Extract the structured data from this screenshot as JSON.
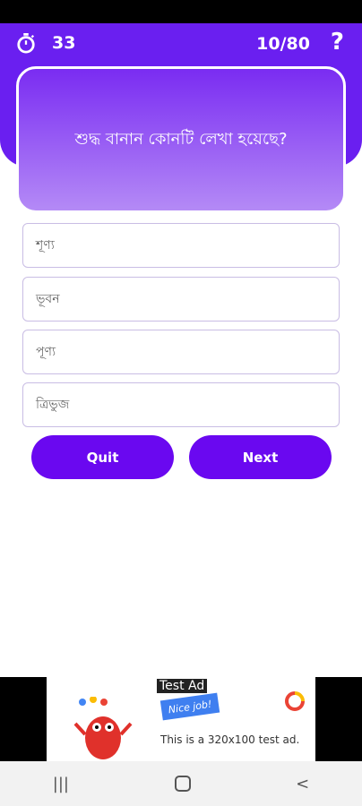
{
  "header": {
    "timer_value": "33",
    "progress": "10/80",
    "help_icon": "?"
  },
  "question": {
    "text": "শুদ্ধ বানান কোনটি লেখা হয়েছে?"
  },
  "options": [
    {
      "label": "শূণ্য"
    },
    {
      "label": "ভূবন"
    },
    {
      "label": "পূণ্য"
    },
    {
      "label": "ত্রিভুজ"
    }
  ],
  "buttons": {
    "quit": "Quit",
    "next": "Next"
  },
  "ad": {
    "label": "Test Ad",
    "banner": "Nice job!",
    "text": "This is a 320x100 test ad."
  },
  "nav": {
    "recent": "|||",
    "back": "<"
  },
  "colors": {
    "primary": "#6a08f0",
    "header": "#6a1ff0"
  }
}
